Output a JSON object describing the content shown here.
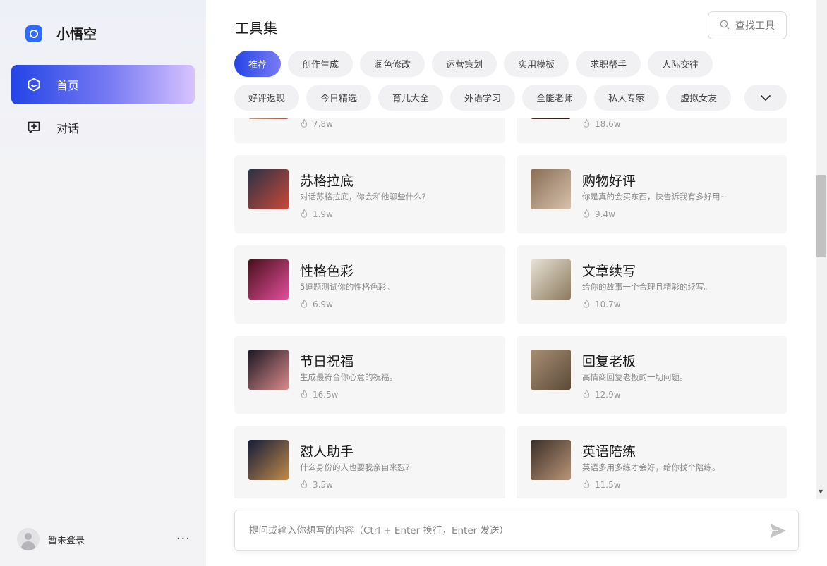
{
  "brand": {
    "name": "小悟空",
    "logo_icon": "logo-icon"
  },
  "sidebar": {
    "items": [
      {
        "label": "首页",
        "icon": "home-hexagon-icon",
        "active": true
      },
      {
        "label": "对话",
        "icon": "chat-plus-icon",
        "active": false
      }
    ],
    "user": {
      "name": "暂未登录",
      "more": "···"
    }
  },
  "main": {
    "title": "工具集",
    "search": {
      "label": "查找工具",
      "icon": "search-icon"
    },
    "categories_row1": [
      "推荐",
      "创作生成",
      "润色修改",
      "运营策划",
      "实用模板",
      "求职帮手",
      "人际交往"
    ],
    "categories_row2": [
      "好评返现",
      "今日精选",
      "育儿大全",
      "外语学习",
      "全能老师",
      "私人专家",
      "虚拟女友"
    ],
    "active_category": "推荐",
    "cards": [
      {
        "title": "",
        "desc": "",
        "count": "7.8w",
        "thumb": [
          "#e8d8cc",
          "#a4563f"
        ]
      },
      {
        "title": "",
        "desc": "",
        "count": "18.6w",
        "thumb": [
          "#6b4030",
          "#2a1a14"
        ]
      },
      {
        "title": "苏格拉底",
        "desc": "对话苏格拉底，你会和他聊些什么?",
        "count": "1.9w",
        "thumb": [
          "#2a3246",
          "#c9483a"
        ]
      },
      {
        "title": "购物好评",
        "desc": "你是真的会买东西，快告诉我有多好用~",
        "count": "9.4w",
        "thumb": [
          "#8a6d55",
          "#d6c2ad"
        ]
      },
      {
        "title": "性格色彩",
        "desc": "5道题测试你的性格色彩。",
        "count": "6.9w",
        "thumb": [
          "#4a0f1c",
          "#e04f9a"
        ]
      },
      {
        "title": "文章续写",
        "desc": "给你的故事一个合理且精彩的续写。",
        "count": "10.7w",
        "thumb": [
          "#e8e2d6",
          "#8c7a5e"
        ]
      },
      {
        "title": "节日祝福",
        "desc": "生成最符合你心意的祝福。",
        "count": "16.5w",
        "thumb": [
          "#1b1724",
          "#d98a8a"
        ]
      },
      {
        "title": "回复老板",
        "desc": "高情商回复老板的一切问题。",
        "count": "12.9w",
        "thumb": [
          "#a88f72",
          "#5b4a3a"
        ]
      },
      {
        "title": "怼人助手",
        "desc": "什么身份的人也要我亲自来怼?",
        "count": "3.5w",
        "thumb": [
          "#141c3a",
          "#c08a4a"
        ]
      },
      {
        "title": "英语陪练",
        "desc": "英语多用多练才会好，给你找个陪练。",
        "count": "11.5w",
        "thumb": [
          "#3a2e26",
          "#b9957a"
        ]
      }
    ],
    "stat_icon": "fire-icon"
  },
  "composer": {
    "placeholder": "提问或输入你想写的内容（Ctrl + Enter 换行，Enter 发送）",
    "send_icon": "send-icon"
  },
  "colors": {
    "accent": "#2344e6",
    "accent_end": "#d8c3ff",
    "card_bg": "#f6f6f7",
    "chip_bg": "#f1f1f3"
  }
}
